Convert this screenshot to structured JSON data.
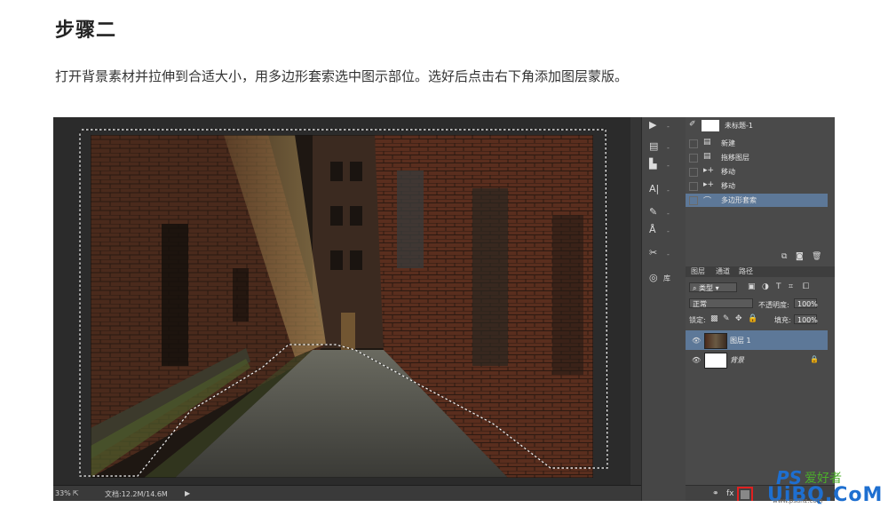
{
  "article": {
    "step_title": "步骤二",
    "instruction": "打开背景素材并拉伸到合适大小，用多边形套索选中图示部位。选好后点击右下角添加图层蒙版。"
  },
  "statusbar": {
    "zoom": "33%",
    "doc_info": "文档:12.2M/14.6M"
  },
  "toolstrip": {
    "tools": [
      {
        "icon": "play-icon",
        "glyph": "▶"
      },
      {
        "icon": "histogram-icon",
        "glyph": "▤"
      },
      {
        "icon": "align-icon",
        "glyph": "▙"
      },
      {
        "icon": "character-icon",
        "glyph": "A|"
      },
      {
        "icon": "brush-settings-icon",
        "glyph": "✎"
      },
      {
        "icon": "clone-source-icon",
        "glyph": "Å"
      },
      {
        "icon": "tool-presets-icon",
        "glyph": "✂"
      }
    ],
    "library_label": "库"
  },
  "history": {
    "snapshot_name": "未标题-1",
    "items": [
      "新建",
      "拖移图层",
      "移动",
      "移动",
      "多边形套索"
    ],
    "selected_index": 4
  },
  "layers_panel": {
    "tabs": [
      "图层",
      "通道",
      "路径"
    ],
    "filter_type": "类型",
    "blend_mode": "正常",
    "opacity_label": "不透明度:",
    "opacity_value": "100%",
    "lock_label": "锁定:",
    "fill_label": "填充:",
    "fill_value": "100%",
    "layers": [
      {
        "name": "图层 1",
        "selected": true
      },
      {
        "name": "背景",
        "selected": false
      }
    ]
  },
  "watermark": {
    "ps_text": "PS",
    "cn_text": "爱好者",
    "site": "UiBQ.CoM",
    "small": "www.psahz.com"
  },
  "colors": {
    "selection_highlight": "#5d7898",
    "panel_bg": "#4a4a4a",
    "watermark_blue": "#1e6fd0",
    "watermark_green": "#4caf2a"
  }
}
